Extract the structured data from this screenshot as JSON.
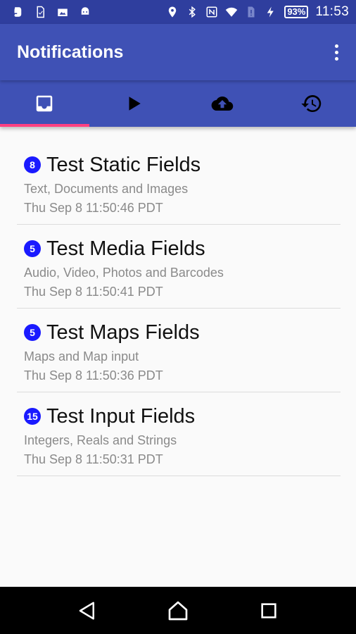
{
  "status_bar": {
    "left_icons": [
      "evernote-icon",
      "sim-card-icon",
      "photo-upload-icon",
      "android-icon"
    ],
    "right_icons": [
      "location-icon",
      "bluetooth-icon",
      "nfc-icon",
      "wifi-icon",
      "sim-alert-icon",
      "charging-icon"
    ],
    "battery": "93%",
    "time": "11:53"
  },
  "app_bar": {
    "title": "Notifications",
    "overflow_icon": "more-vert-icon"
  },
  "tabs": [
    {
      "icon": "inbox-icon",
      "active": true
    },
    {
      "icon": "play-icon",
      "active": false
    },
    {
      "icon": "cloud-upload-icon",
      "active": false
    },
    {
      "icon": "history-icon",
      "active": false
    }
  ],
  "notifications": [
    {
      "badge": "8",
      "title": "Test Static Fields",
      "subtitle": "Text, Documents and Images",
      "timestamp": "Thu Sep 8 11:50:46 PDT"
    },
    {
      "badge": "5",
      "title": "Test Media Fields",
      "subtitle": "Audio, Video, Photos and Barcodes",
      "timestamp": "Thu Sep 8 11:50:41 PDT"
    },
    {
      "badge": "5",
      "title": "Test Maps Fields",
      "subtitle": "Maps and Map input",
      "timestamp": "Thu Sep 8 11:50:36 PDT"
    },
    {
      "badge": "15",
      "title": "Test Input Fields",
      "subtitle": "Integers, Reals and Strings",
      "timestamp": "Thu Sep 8 11:50:31 PDT"
    }
  ],
  "colors": {
    "status_bar": "#2f3e9e",
    "primary": "#3f51b5",
    "tab_indicator": "#ff4081",
    "badge": "#1a1aff"
  },
  "nav_bar": {
    "icons": [
      "back-icon",
      "home-icon",
      "recents-icon"
    ]
  }
}
